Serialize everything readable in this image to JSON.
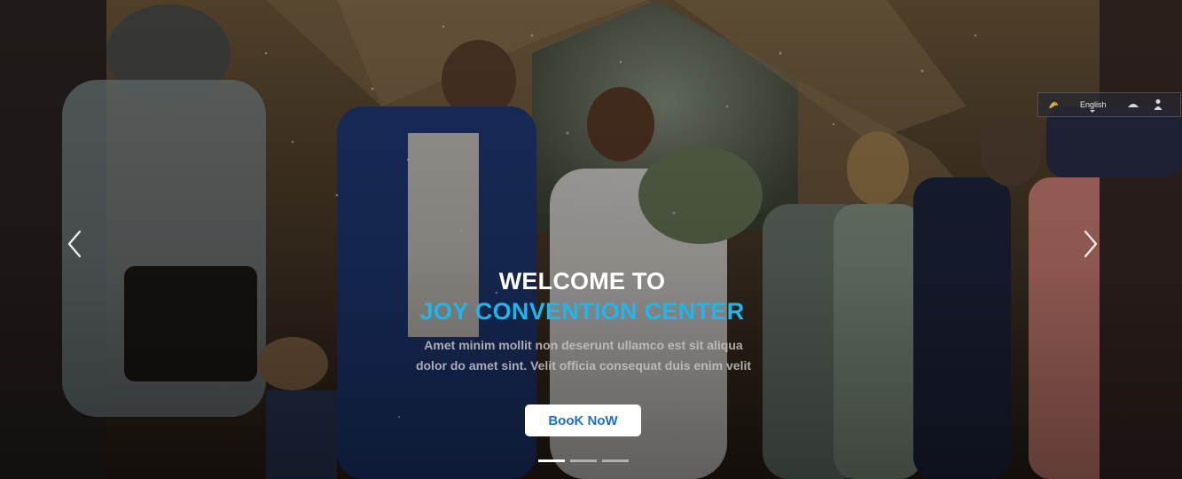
{
  "hero": {
    "title_line1": "WELCOME TO",
    "title_line2": "JOY CONVENTION CENTER",
    "subtitle_line1": "Amet minim mollit non deserunt ullamco est sit aliqua",
    "subtitle_line2": "dolor do amet sint. Velit officia consequat duis enim velit",
    "button_label": "BooK NoW",
    "active_slide": 1,
    "slide_count": 3
  },
  "language": {
    "selected": "English"
  },
  "colors": {
    "accent": "#1bb7ee",
    "button_text": "#1a6fd9",
    "button_bg": "#ffffff"
  },
  "icons": {
    "prev": "chevron-left-icon",
    "next": "chevron-right-icon",
    "flag": "flag-icon"
  }
}
